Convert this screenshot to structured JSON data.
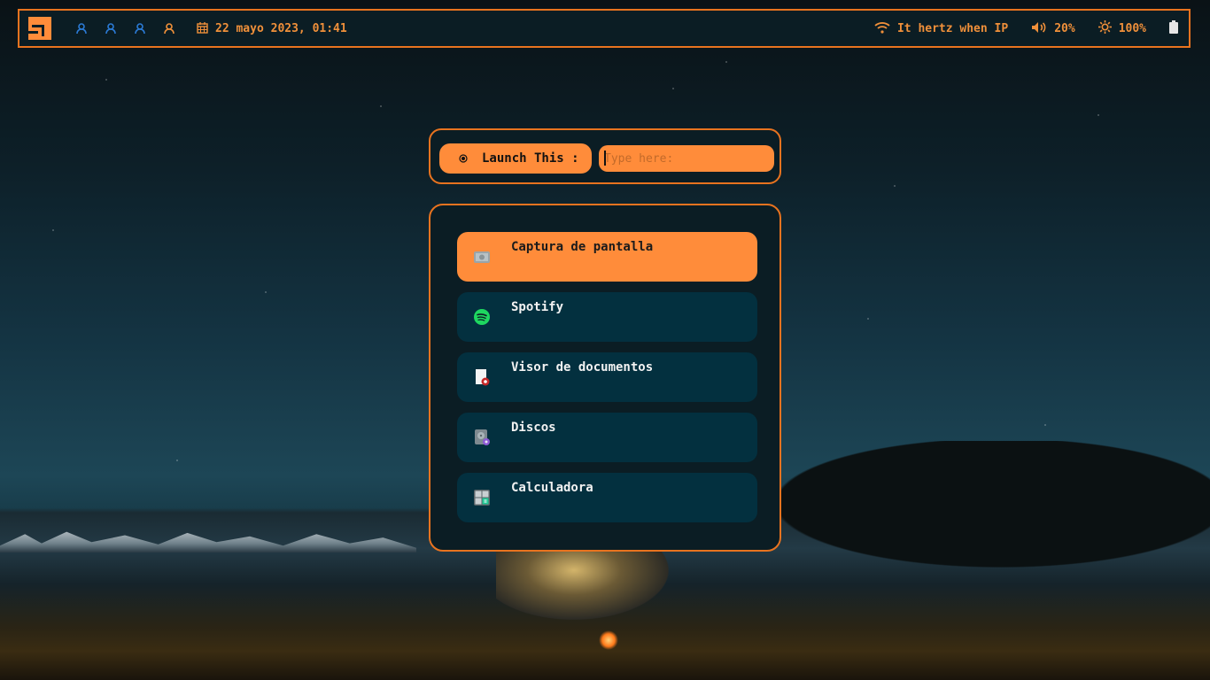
{
  "topbar": {
    "workspaces": [
      {
        "icon": "user-icon",
        "color": "#2b7bd6"
      },
      {
        "icon": "user-icon",
        "color": "#2b7bd6"
      },
      {
        "icon": "user-icon",
        "color": "#2b7bd6"
      },
      {
        "icon": "user-icon",
        "color": "#f0903a"
      }
    ],
    "datetime": "22 mayo 2023, 01:41",
    "wifi_label": "It hertz when IP",
    "volume": "20%",
    "brightness": "100%"
  },
  "launcher": {
    "label": "Launch This :",
    "placeholder": "Type here:"
  },
  "apps": [
    {
      "label": "Captura de pantalla",
      "icon": "screenshot-icon",
      "selected": true
    },
    {
      "label": "Spotify",
      "icon": "spotify-icon",
      "selected": false
    },
    {
      "label": "Visor de documentos",
      "icon": "document-viewer-icon",
      "selected": false
    },
    {
      "label": "Discos",
      "icon": "disks-icon",
      "selected": false
    },
    {
      "label": "Calculadora",
      "icon": "calculator-icon",
      "selected": false
    }
  ],
  "colors": {
    "accent": "#ff8c3a",
    "border": "#e8731f",
    "panel": "#0b1d24",
    "item": "#03303f",
    "workspace": "#2b7bd6"
  }
}
